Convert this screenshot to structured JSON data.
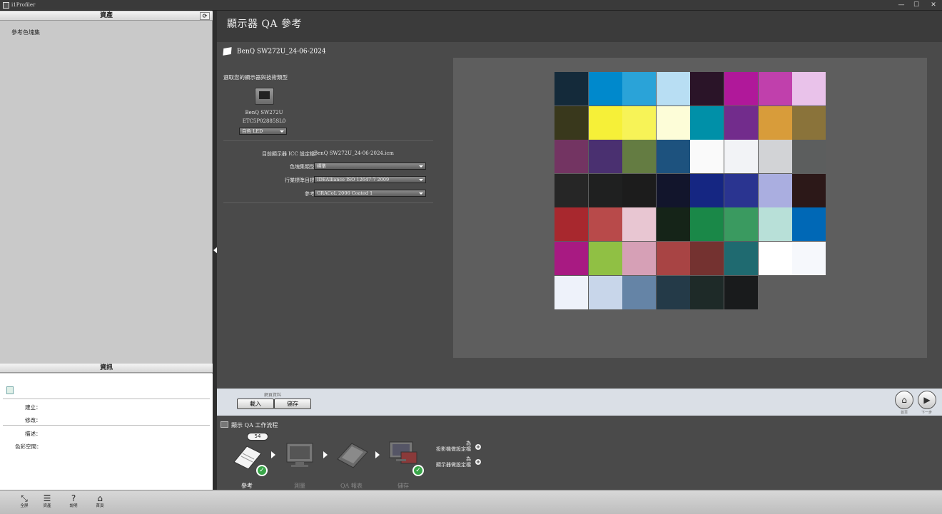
{
  "window": {
    "title": "i1Profiler",
    "minimize": "—",
    "maximize": "☐",
    "close": "✕"
  },
  "assets_panel": {
    "header": "資產",
    "refresh": "⟳",
    "items": [
      "參考色塊集"
    ]
  },
  "info_panel": {
    "header": "資訊",
    "fields": {
      "created": "建立：",
      "modified": "修改：",
      "description": "描述：",
      "color_space": "色彩空間："
    }
  },
  "main": {
    "title": "顯示器 QA 參考",
    "profile_name": "BenQ SW272U_24-06-2024",
    "section_label": "選取您的顯示器與技術類型",
    "monitor": {
      "model": "BenQ SW272U",
      "serial": "ETC5P02885SL0",
      "technology": "白色 LED"
    },
    "form": {
      "icc_label": "目前顯示器 ICC 設定檔：",
      "icc_value": "BenQ SW272U_24-06-2024.icm",
      "patch_set_label": "色塊集類型：",
      "patch_set_value": "標準",
      "industry_label": "行業標準目標：",
      "industry_value": "IDEAlliance ISO 12647-7 2009",
      "reference_label": "參考：",
      "reference_value": "GRACoL 2006 Coated 1"
    }
  },
  "patches": [
    [
      "#142a3a",
      "#0089cc",
      "#2aa3d8",
      "#b8def3",
      "#2a1428",
      "#b0189a",
      "#c040ac",
      "#e9c2ea"
    ],
    [
      "#39381c",
      "#f6f038",
      "#f7f357",
      "#fdfdd8",
      "#0090a8",
      "#722c8c",
      "#d89c3a",
      "#8a733a"
    ],
    [
      "#733462",
      "#4a3070",
      "#647c42",
      "#1d527e",
      "#fafafa",
      "#f2f3f6",
      "#d2d3d6",
      "#5c5e5e"
    ],
    [
      "#262626",
      "#1f2020",
      "#1c1c1c",
      "#12152c",
      "#152682",
      "#2a3490",
      "#aaaee0",
      "#2c1818"
    ],
    [
      "#a8282e",
      "#b84a4a",
      "#e8c6d2",
      "#152418",
      "#1a8848",
      "#3a9a60",
      "#b8e0d8",
      "#0068b6"
    ],
    [
      "#a81a82",
      "#90c044",
      "#d6a0b6",
      "#a84444",
      "#743230",
      "#1f6a70",
      "#ffffff",
      "#f6f8fc"
    ],
    [
      "#eef2fa",
      "#c8d6ea",
      "#6584a6",
      "#243a48",
      "#1e2a28",
      "#191b1c"
    ]
  ],
  "bottom_bar": {
    "caption": "網頁資料",
    "load": "載入",
    "save": "儲存",
    "home_label": "首頁",
    "next_label": "下一步"
  },
  "workflow": {
    "title": "顯示 QA 工作流程",
    "badge": "54",
    "steps": [
      "參考",
      "測量",
      "QA 報表",
      "儲存"
    ],
    "note_projector": "為\n投影機做設定檔",
    "note_monitor": "為\n顯示器做設定檔"
  },
  "toolbar": {
    "items": [
      {
        "icon": "⤡",
        "label": "全屏"
      },
      {
        "icon": "☰",
        "label": "資產"
      },
      {
        "icon": "?",
        "label": "說明"
      },
      {
        "icon": "⌂",
        "label": "首頁"
      }
    ]
  }
}
